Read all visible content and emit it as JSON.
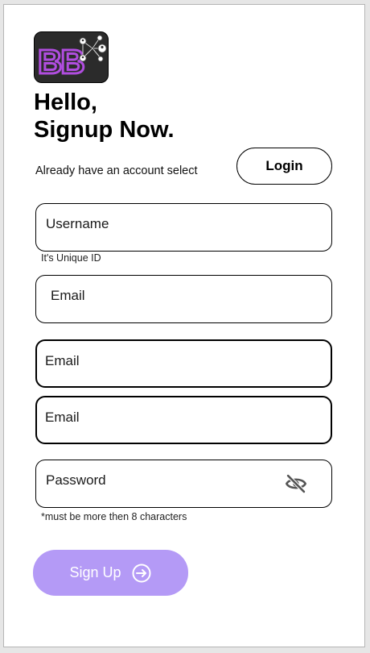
{
  "logo": {
    "letters": "BB",
    "icon": "network-people-icon",
    "accent_color": "#b04ddf",
    "background_color": "#2b2b2b"
  },
  "heading": {
    "line1": "Hello,",
    "line2": "Signup Now."
  },
  "account_prompt": "Already have an account select",
  "login_button": "Login",
  "fields": {
    "username": {
      "label": "Username",
      "hint": "It's Unique ID"
    },
    "email_1": {
      "label": "Email"
    },
    "email_2": {
      "label": "Email"
    },
    "email_3": {
      "label": "Email"
    },
    "password": {
      "label": "Password",
      "hint": "*must be more then 8 characters",
      "toggle_icon": "eye-off-icon"
    }
  },
  "signup_button": {
    "label": "Sign Up",
    "icon": "arrow-right-circle-icon",
    "color": "#b49af6"
  }
}
